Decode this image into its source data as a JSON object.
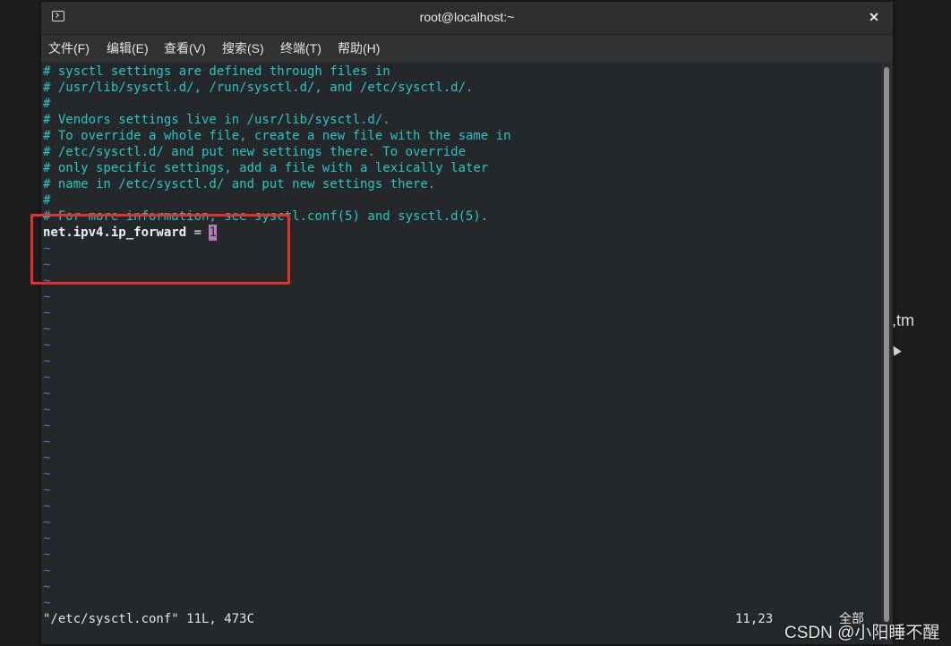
{
  "window": {
    "title": "root@localhost:~",
    "close_glyph": "✕"
  },
  "menu": {
    "items": [
      "文件(F)",
      "编辑(E)",
      "查看(V)",
      "搜索(S)",
      "终端(T)",
      "帮助(H)"
    ]
  },
  "editor": {
    "comment_lines": [
      "# sysctl settings are defined through files in",
      "# /usr/lib/sysctl.d/, /run/sysctl.d/, and /etc/sysctl.d/.",
      "#",
      "# Vendors settings live in /usr/lib/sysctl.d/.",
      "# To override a whole file, create a new file with the same in",
      "# /etc/sysctl.d/ and put new settings there. To override",
      "# only specific settings, add a file with a lexically later",
      "# name in /etc/sysctl.d/ and put new settings there.",
      "#",
      "# For more information, see sysctl.conf(5) and sysctl.d(5)."
    ],
    "setting_key": "net.ipv4.ip_forward",
    "setting_eq": " = ",
    "setting_value": "1",
    "tilde": "~",
    "status_file": "\"/etc/sysctl.conf\" 11L, 473C",
    "status_position": "11,23",
    "status_all": "全部"
  },
  "colors": {
    "comment": "#29c5c5",
    "tilde": "#4a73c6",
    "cursor": "#b77bb3",
    "highlight_box": "#e5302a"
  },
  "desktop": {
    "side_text": ",tm",
    "watermark": "CSDN @小阳睡不醒"
  }
}
